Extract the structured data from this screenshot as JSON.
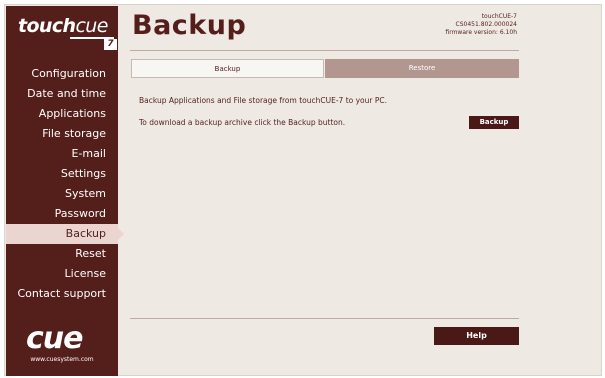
{
  "brand": {
    "word_bold": "touch",
    "word_light": "cue",
    "badge": "7"
  },
  "sidebar": {
    "items": [
      {
        "label": "Configuration",
        "active": false
      },
      {
        "label": "Date and time",
        "active": false
      },
      {
        "label": "Applications",
        "active": false
      },
      {
        "label": "File storage",
        "active": false
      },
      {
        "label": "E-mail",
        "active": false
      },
      {
        "label": "Settings",
        "active": false
      },
      {
        "label": "System",
        "active": false
      },
      {
        "label": "Password",
        "active": false
      },
      {
        "label": "Backup",
        "active": true
      },
      {
        "label": "Reset",
        "active": false
      },
      {
        "label": "License",
        "active": false
      },
      {
        "label": "Contact support",
        "active": false
      }
    ],
    "logo_text": "cue",
    "url": "www.cuesystem.com"
  },
  "header": {
    "title": "Backup",
    "device_name": "touchCUE-7",
    "serial": "CS0451.802.000024",
    "firmware": "firmware version: 6.10h"
  },
  "tabs": [
    {
      "label": "Backup",
      "selected": true
    },
    {
      "label": "Restore",
      "selected": false
    }
  ],
  "content": {
    "line_1": "Backup Applications and File storage from touchCUE-7 to your PC.",
    "line_2": "To download a backup archive click the Backup button.",
    "backup_button": "Backup",
    "help_button": "Help"
  },
  "colors": {
    "sidebar_bg": "#541e1b",
    "page_bg": "#eeeae3",
    "accent": "#4a1816",
    "tab_inactive": "#b29791",
    "active_item_bg": "#ead5d0"
  }
}
